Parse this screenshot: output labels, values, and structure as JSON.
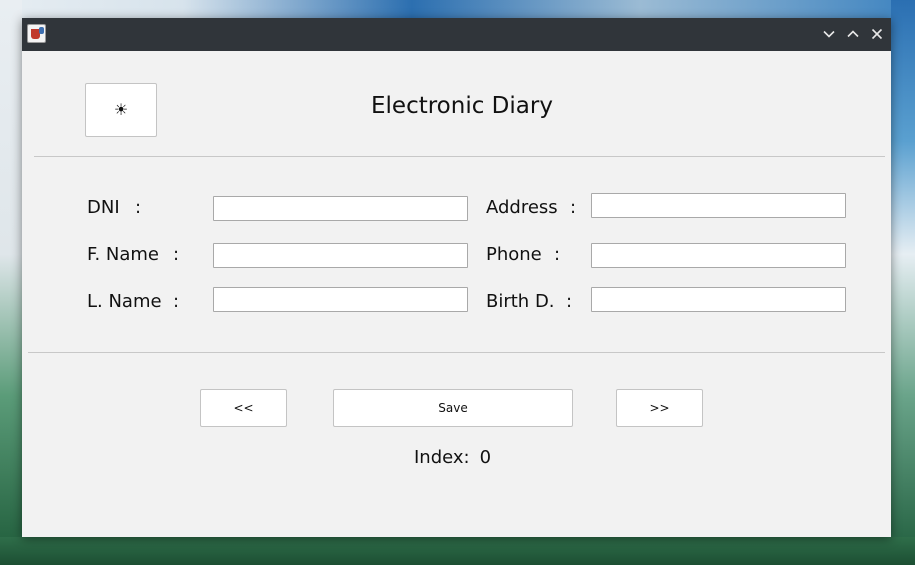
{
  "window": {
    "app_icon": "java-cup-icon",
    "controls": {
      "minimize_icon": "chevron-down-icon",
      "maximize_icon": "chevron-up-icon",
      "close_icon": "close-icon"
    }
  },
  "header": {
    "theme_button_glyph": "☀",
    "theme_button_icon": "sun-icon",
    "title": "Electronic Diary"
  },
  "form": {
    "colon": ":",
    "left": [
      {
        "label": "DNI",
        "value": ""
      },
      {
        "label": "F. Name",
        "value": ""
      },
      {
        "label": "L. Name",
        "value": ""
      }
    ],
    "right": [
      {
        "label": "Address",
        "value": ""
      },
      {
        "label": "Phone",
        "value": ""
      },
      {
        "label": "Birth D.",
        "value": ""
      }
    ]
  },
  "nav": {
    "prev_label": "<<",
    "save_label": "Save",
    "next_label": ">>"
  },
  "status": {
    "index_label": "Index:",
    "index_value": "0"
  },
  "colors": {
    "titlebar": "#30353a",
    "window_bg": "#f2f2f2"
  }
}
